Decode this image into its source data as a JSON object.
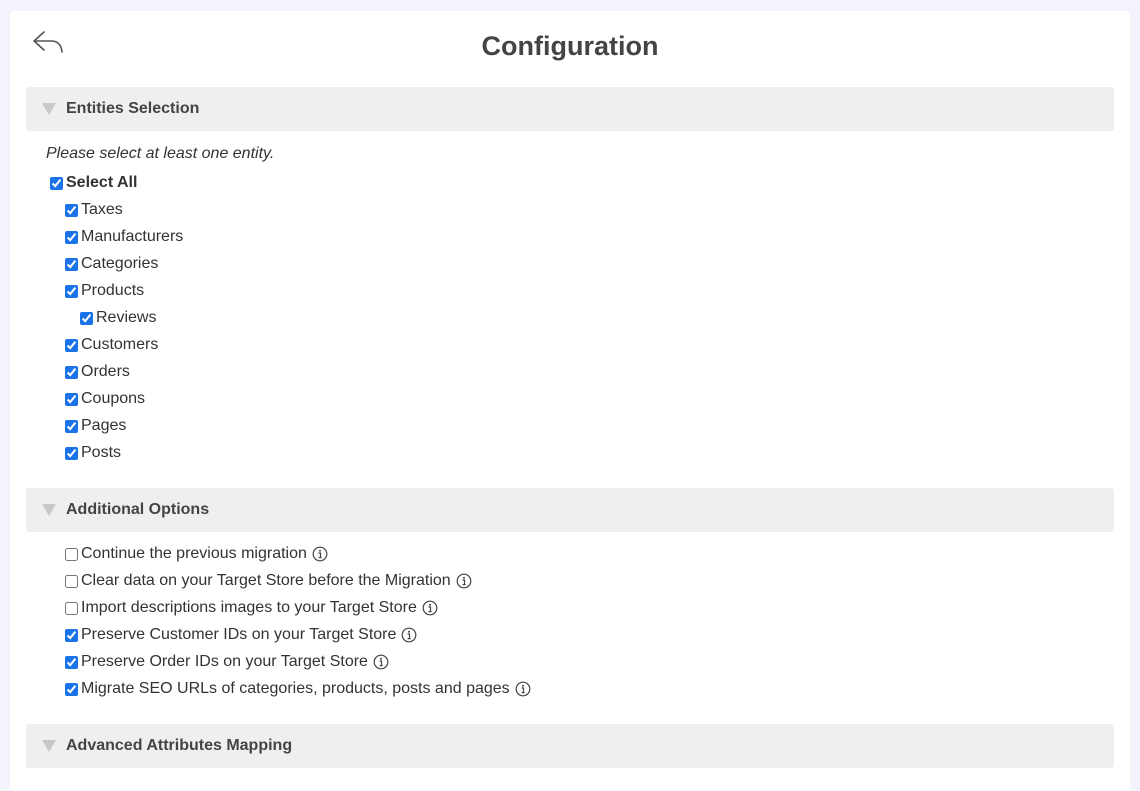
{
  "page": {
    "title": "Configuration"
  },
  "icons": {
    "back": "reply-arrow-icon",
    "collapse": "triangle-down-icon",
    "info": "info-circle-icon"
  },
  "accent_color": "#1a73e8",
  "entities_section": {
    "title": "Entities Selection",
    "note": "Please select at least one entity.",
    "select_all": {
      "label": "Select All",
      "checked": true
    },
    "items": [
      {
        "label": "Taxes",
        "checked": true
      },
      {
        "label": "Manufacturers",
        "checked": true
      },
      {
        "label": "Categories",
        "checked": true
      },
      {
        "label": "Products",
        "checked": true
      },
      {
        "label": "Reviews",
        "checked": true
      },
      {
        "label": "Customers",
        "checked": true
      },
      {
        "label": "Orders",
        "checked": true
      },
      {
        "label": "Coupons",
        "checked": true
      },
      {
        "label": "Pages",
        "checked": true
      },
      {
        "label": "Posts",
        "checked": true
      }
    ]
  },
  "additional_section": {
    "title": "Additional Options",
    "options": [
      {
        "label": "Continue the previous migration",
        "checked": false
      },
      {
        "label": "Clear data on your Target Store before the Migration",
        "checked": false
      },
      {
        "label": "Import descriptions images to your Target Store",
        "checked": false
      },
      {
        "label": "Preserve Customer IDs on your Target Store",
        "checked": true
      },
      {
        "label": "Preserve Order IDs on your Target Store",
        "checked": true
      },
      {
        "label": "Migrate SEO URLs of categories, products, posts and pages",
        "checked": true
      }
    ]
  },
  "advanced_section": {
    "title": "Advanced Attributes Mapping"
  }
}
